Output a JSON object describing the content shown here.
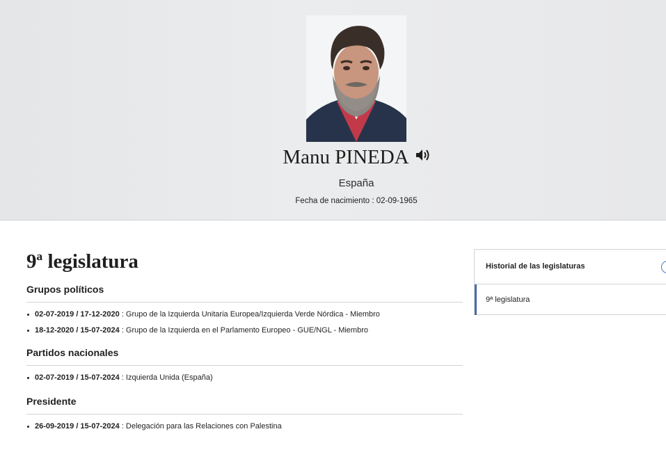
{
  "profile": {
    "name": "Manu PINEDA",
    "country": "España",
    "birth_label": "Fecha de nacimiento",
    "birth_separator": " : ",
    "birth_date": "02-09-1965",
    "speaker_icon": "speaker-icon"
  },
  "term": {
    "title": "9ª legislatura",
    "sections": [
      {
        "title": "Grupos políticos",
        "entries": [
          {
            "dates": "02-07-2019 / 17-12-2020",
            "sep": " : ",
            "text": "Grupo de la Izquierda Unitaria Europea/Izquierda Verde Nórdica - Miembro"
          },
          {
            "dates": "18-12-2020 / 15-07-2024",
            "sep": " : ",
            "text": "Grupo de la Izquierda en el Parlamento Europeo - GUE/NGL - Miembro"
          }
        ]
      },
      {
        "title": "Partidos nacionales",
        "entries": [
          {
            "dates": "02-07-2019 / 15-07-2024",
            "sep": " : ",
            "text": "Izquierda Unida (España)"
          }
        ]
      },
      {
        "title": "Presidente",
        "entries": [
          {
            "dates": "26-09-2019 / 15-07-2024",
            "sep": " : ",
            "text": "Delegación para las Relaciones con Palestina"
          }
        ]
      }
    ]
  },
  "sidebar": {
    "title": "Historial de las legislaturas",
    "items": [
      {
        "label": "9ª legislatura"
      }
    ],
    "accent_color": "#4a6fa5"
  }
}
